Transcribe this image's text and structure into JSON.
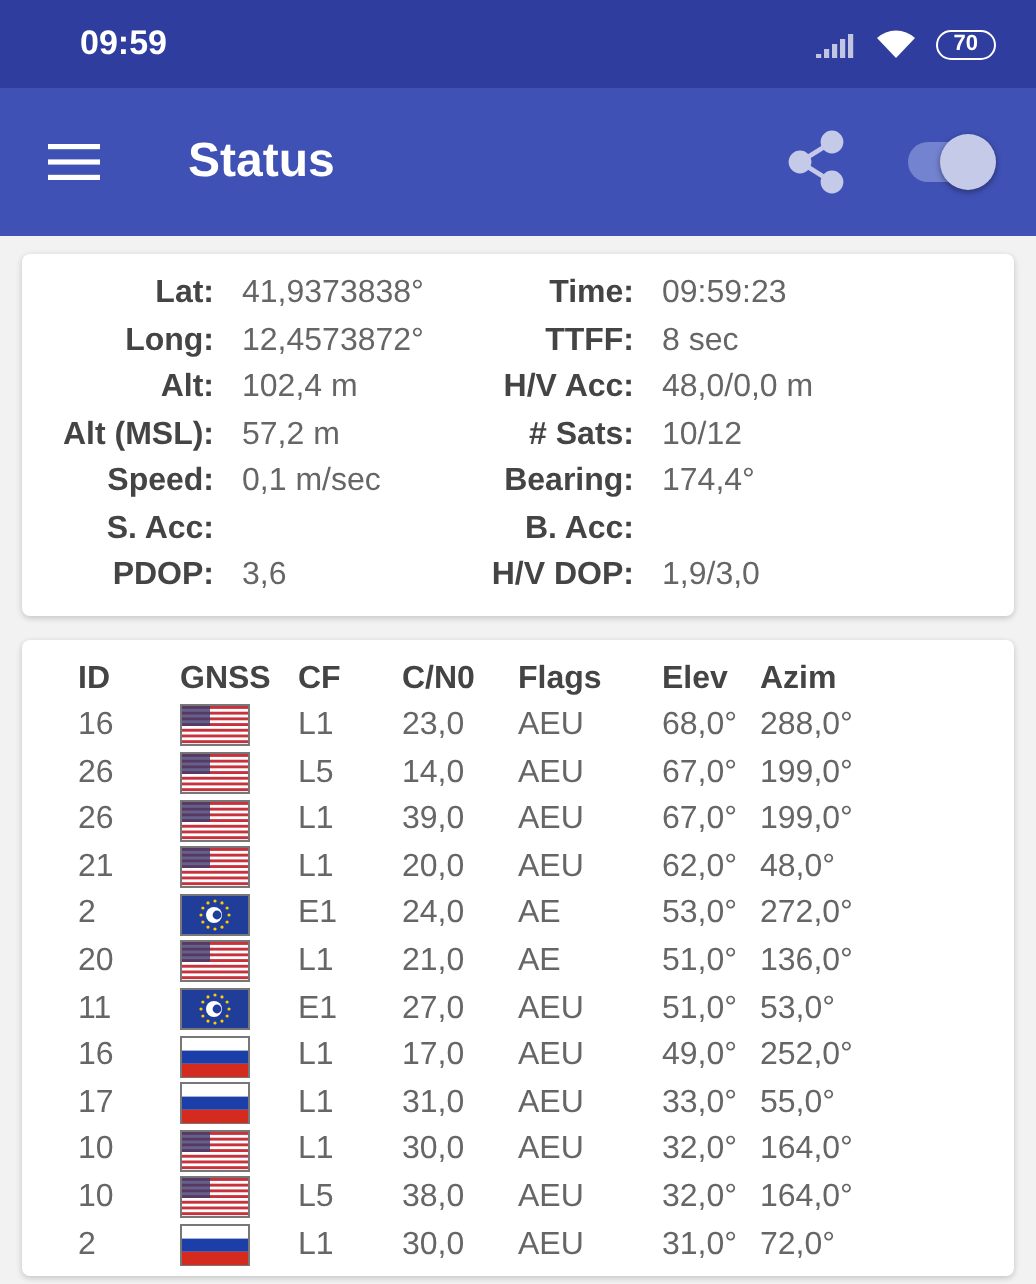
{
  "status_bar": {
    "time": "09:59",
    "battery": "70"
  },
  "app_bar": {
    "title": "Status",
    "switch": {
      "on": true
    }
  },
  "fix": {
    "rows": [
      {
        "label": "Lat:",
        "value": "41,9373838°",
        "label_2": "Time:",
        "value_2": "09:59:23"
      },
      {
        "label": "Long:",
        "value": "12,4573872°",
        "label_2": "TTFF:",
        "value_2": "8 sec"
      },
      {
        "label": "Alt:",
        "value": "102,4 m",
        "label_2": "H/V Acc:",
        "value_2": "48,0/0,0 m"
      },
      {
        "label": "Alt (MSL):",
        "value": "57,2 m",
        "label_2": "# Sats:",
        "value_2": "10/12"
      },
      {
        "label": "Speed:",
        "value": "0,1 m/sec",
        "label_2": "Bearing:",
        "value_2": "174,4°"
      },
      {
        "label": "S. Acc:",
        "label_2": "B. Acc:"
      },
      {
        "label": "PDOP:",
        "value": "3,6",
        "label_2": "H/V DOP:",
        "value_2": "1,9/3,0"
      }
    ]
  },
  "satellites": {
    "columns": [
      "ID",
      "GNSS",
      "CF",
      "C/N0",
      "Flags",
      "Elev",
      "Azim"
    ],
    "rows": [
      {
        "id": "16",
        "kind": "usa",
        "cf": "L1",
        "cn0": "23,0",
        "flags": "AEU",
        "elev": "68,0°",
        "azim": "288,0°"
      },
      {
        "id": "26",
        "kind": "usa",
        "cf": "L5",
        "cn0": "14,0",
        "flags": "AEU",
        "elev": "67,0°",
        "azim": "199,0°"
      },
      {
        "id": "26",
        "kind": "usa",
        "cf": "L1",
        "cn0": "39,0",
        "flags": "AEU",
        "elev": "67,0°",
        "azim": "199,0°"
      },
      {
        "id": "21",
        "kind": "usa",
        "cf": "L1",
        "cn0": "20,0",
        "flags": "AEU",
        "elev": "62,0°",
        "azim": "48,0°"
      },
      {
        "id": "2",
        "kind": "galileo",
        "cf": "E1",
        "cn0": "24,0",
        "flags": "AE",
        "elev": "53,0°",
        "azim": "272,0°"
      },
      {
        "id": "20",
        "kind": "usa",
        "cf": "L1",
        "cn0": "21,0",
        "flags": "AE",
        "elev": "51,0°",
        "azim": "136,0°"
      },
      {
        "id": "11",
        "kind": "galileo",
        "cf": "E1",
        "cn0": "27,0",
        "flags": "AEU",
        "elev": "51,0°",
        "azim": "53,0°"
      },
      {
        "id": "16",
        "kind": "russia",
        "cf": "L1",
        "cn0": "17,0",
        "flags": "AEU",
        "elev": "49,0°",
        "azim": "252,0°"
      },
      {
        "id": "17",
        "kind": "russia",
        "cf": "L1",
        "cn0": "31,0",
        "flags": "AEU",
        "elev": "33,0°",
        "azim": "55,0°"
      },
      {
        "id": "10",
        "kind": "usa",
        "cf": "L1",
        "cn0": "30,0",
        "flags": "AEU",
        "elev": "32,0°",
        "azim": "164,0°"
      },
      {
        "id": "10",
        "kind": "usa",
        "cf": "L5",
        "cn0": "38,0",
        "flags": "AEU",
        "elev": "32,0°",
        "azim": "164,0°"
      },
      {
        "id": "2",
        "kind": "russia",
        "cf": "L1",
        "cn0": "30,0",
        "flags": "AEU",
        "elev": "31,0°",
        "azim": "72,0°"
      }
    ]
  }
}
